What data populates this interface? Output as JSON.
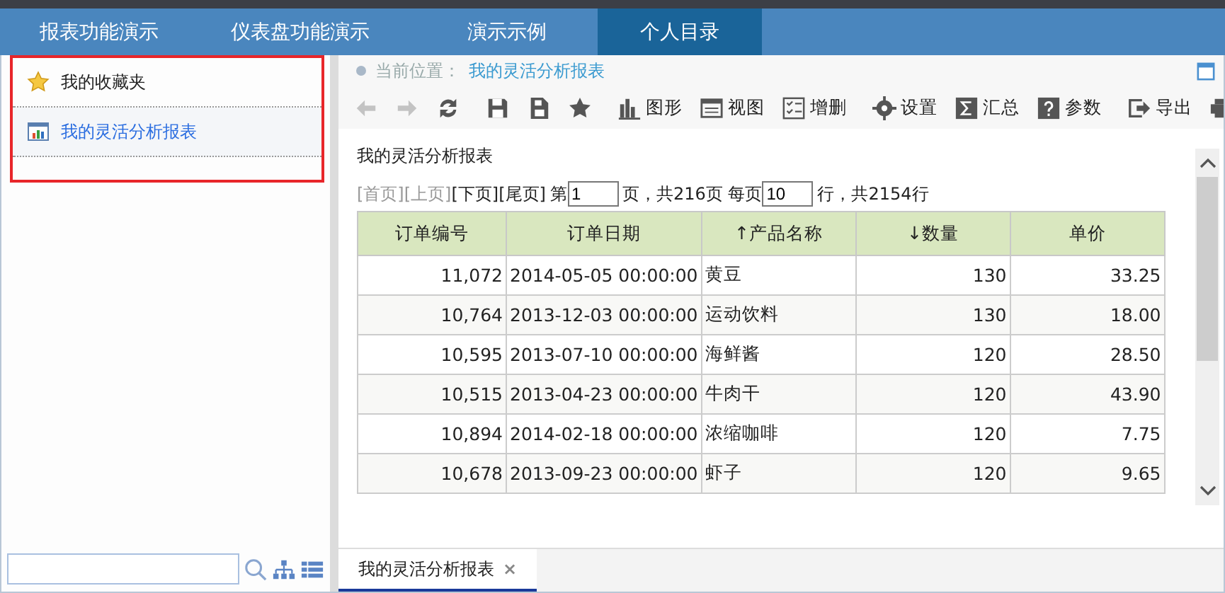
{
  "top_tabs": [
    {
      "label": "报表功能演示",
      "selected": false
    },
    {
      "label": "仪表盘功能演示",
      "selected": false
    },
    {
      "label": "演示示例",
      "selected": false
    },
    {
      "label": "个人目录",
      "selected": true
    }
  ],
  "sidebar": {
    "items": [
      {
        "label": "我的收藏夹",
        "kind": "favorites",
        "selected": false
      },
      {
        "label": "我的灵活分析报表",
        "kind": "report",
        "selected": true
      }
    ]
  },
  "breadcrumb": {
    "label": "当前位置：",
    "value": "我的灵活分析报表"
  },
  "toolbar": [
    {
      "kind": "back",
      "disabled": true
    },
    {
      "kind": "forward",
      "disabled": true
    },
    {
      "kind": "refresh",
      "disabled": false
    },
    {
      "kind": "save",
      "disabled": false
    },
    {
      "kind": "save-as",
      "disabled": false
    },
    {
      "kind": "star",
      "disabled": false
    },
    {
      "kind": "chart",
      "label": "图形",
      "disabled": false
    },
    {
      "kind": "view",
      "label": "视图",
      "disabled": false
    },
    {
      "kind": "edit",
      "label": "增删",
      "disabled": false
    },
    {
      "kind": "settings",
      "label": "设置",
      "disabled": false
    },
    {
      "kind": "sum",
      "label": "汇总",
      "disabled": false
    },
    {
      "kind": "help",
      "label": "参数",
      "disabled": false
    },
    {
      "kind": "export",
      "label": "导出",
      "disabled": false
    },
    {
      "kind": "print",
      "disabled": false
    }
  ],
  "report": {
    "title": "我的灵活分析报表",
    "pager": {
      "links": [
        {
          "label": "[首页]",
          "disabled": true
        },
        {
          "label": "[上页]",
          "disabled": true
        },
        {
          "label": "[下页]",
          "disabled": false
        },
        {
          "label": "[尾页]",
          "disabled": false
        }
      ],
      "page_prefix": "第",
      "page": "1",
      "page_suffix": "页，共216页 每页",
      "per_page": "10",
      "total": "行，共2154行"
    },
    "columns": [
      {
        "label": "订单编号"
      },
      {
        "label": "订单日期"
      },
      {
        "label": "↑产品名称"
      },
      {
        "label": "↓数量"
      },
      {
        "label": "单价"
      }
    ],
    "rows": [
      [
        "11,072",
        "2014-05-05 00:00:00",
        "黄豆",
        "130",
        "33.25"
      ],
      [
        "10,764",
        "2013-12-03 00:00:00",
        "运动饮料",
        "130",
        "18.00"
      ],
      [
        "10,595",
        "2013-07-10 00:00:00",
        "海鲜酱",
        "120",
        "28.50"
      ],
      [
        "10,515",
        "2013-04-23 00:00:00",
        "牛肉干",
        "120",
        "43.90"
      ],
      [
        "10,894",
        "2014-02-18 00:00:00",
        "浓缩咖啡",
        "120",
        "7.75"
      ],
      [
        "10,678",
        "2013-09-23 00:00:00",
        "虾子",
        "120",
        "9.65"
      ]
    ]
  },
  "bottom_tabs": [
    {
      "label": "我的灵活分析报表",
      "close": "×",
      "selected": true
    }
  ]
}
